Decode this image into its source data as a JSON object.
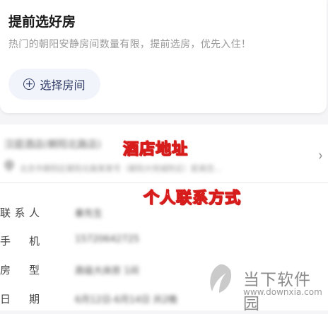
{
  "card": {
    "title": "提前选好房",
    "description": "热门的朝阳安静房间数量有限，提前选房，优先入住！",
    "select_room_label": "选择房间",
    "plus_glyph": "+"
  },
  "hotel": {
    "name": "汉庭酒店(朝阳北路店)",
    "address": "北京市朝阳区朝阳北路某某号（朝阳大悦城附近）距离您...",
    "chevron": "›"
  },
  "annotations": {
    "address": "酒店地址",
    "contact": "个人联系方式"
  },
  "info_rows": [
    {
      "label": "联系人",
      "value": "秦先生"
    },
    {
      "label": "手机",
      "value": "15720642725"
    },
    {
      "label": "房型",
      "value": "高级大床房 1间"
    },
    {
      "label": "日期",
      "value": "6月12日-6月14日 共2晚"
    }
  ],
  "watermark": {
    "brand": "当下软件园",
    "url": "www.downxia.com"
  }
}
